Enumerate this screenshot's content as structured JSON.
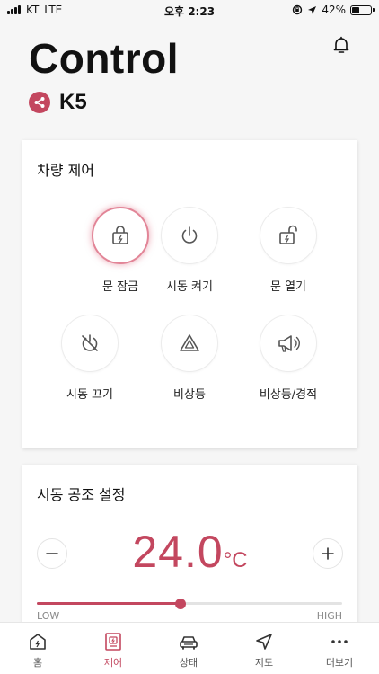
{
  "status_bar": {
    "carrier": "KT",
    "network": "LTE",
    "time": "오후 2:23",
    "battery": "42%",
    "battery_level": 0.42
  },
  "header": {
    "title": "Control",
    "vehicle_name": "K5"
  },
  "vehicle_control": {
    "title": "차량 제어",
    "items": [
      {
        "label": "문 잠금",
        "icon": "lock-icon",
        "active": true
      },
      {
        "label": "시동 켜기",
        "icon": "power-icon",
        "active": false
      },
      {
        "label": "문 열기",
        "icon": "unlock-icon",
        "active": false
      },
      {
        "label": "시동 끄기",
        "icon": "power-off-icon",
        "active": false
      },
      {
        "label": "비상등",
        "icon": "hazard-icon",
        "active": false
      },
      {
        "label": "비상등/경적",
        "icon": "horn-icon",
        "active": false
      }
    ]
  },
  "climate": {
    "title": "시동 공조 설정",
    "temperature": "24.0",
    "unit": "°C",
    "slider_fraction": 0.47,
    "low_label": "LOW",
    "high_label": "HIGH"
  },
  "tabs": [
    {
      "label": "홈",
      "icon": "home-icon",
      "active": false
    },
    {
      "label": "제어",
      "icon": "remote-icon",
      "active": true
    },
    {
      "label": "상태",
      "icon": "car-icon",
      "active": false
    },
    {
      "label": "지도",
      "icon": "navigation-icon",
      "active": false
    },
    {
      "label": "더보기",
      "icon": "more-icon",
      "active": false
    }
  ],
  "colors": {
    "accent": "#c3475f",
    "background": "#f6f6f6"
  }
}
